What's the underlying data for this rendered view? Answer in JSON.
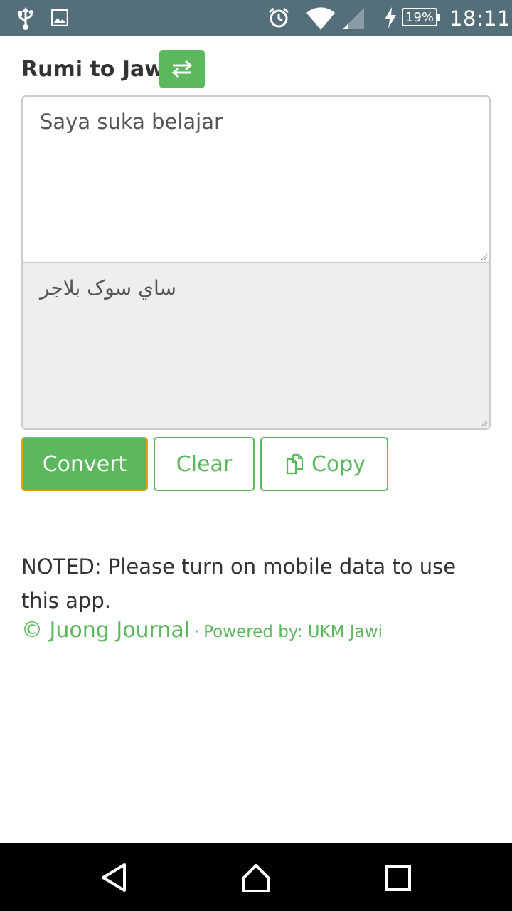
{
  "status_bar": {
    "time": "18:11",
    "battery": "19%",
    "icons": [
      "usb-icon",
      "image-icon",
      "alarm-icon",
      "wifi-icon",
      "cell-signal-icon",
      "charging-icon",
      "battery-icon"
    ]
  },
  "header": {
    "title": "Rumi to Jawi",
    "swap_icon": "swap-arrows-icon"
  },
  "input": {
    "value": "Saya suka belajar"
  },
  "output": {
    "value": "ساي سوک بلاجر"
  },
  "buttons": {
    "convert": "Convert",
    "clear": "Clear",
    "copy": "Copy"
  },
  "note": "NOTED: Please turn on mobile data to use this app.",
  "footer": {
    "copyright": "© Juong Journal",
    "separator": "·",
    "powered": "Powered by: UKM Jawi"
  },
  "colors": {
    "accent": "#5cb85c",
    "status_bar": "#546e7a",
    "focus_border": "#e0a11f"
  },
  "nav_bar": {
    "icons": [
      "back-icon",
      "home-icon",
      "recents-icon"
    ]
  }
}
